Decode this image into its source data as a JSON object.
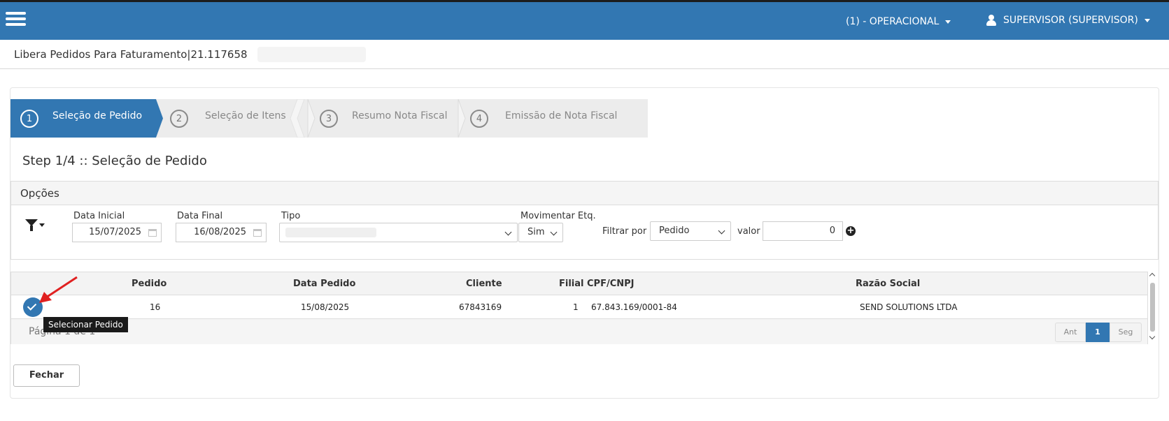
{
  "header": {
    "unit_label": "(1) - OPERACIONAL",
    "user_label": "SUPERVISOR (SUPERVISOR)"
  },
  "page": {
    "title": "Libera Pedidos Para Faturamento|21.117658"
  },
  "wizard": {
    "steps": [
      {
        "num": "1",
        "label": "Seleção de Pedido",
        "active": true
      },
      {
        "num": "2",
        "label": "Seleção de Itens",
        "active": false
      },
      {
        "num": "3",
        "label": "Resumo Nota Fiscal",
        "active": false
      },
      {
        "num": "4",
        "label": "Emissão de Nota Fiscal",
        "active": false
      }
    ],
    "heading": "Step 1/4 :: Seleção de Pedido"
  },
  "options": {
    "title": "Opções",
    "data_inicial_label": "Data Inicial",
    "data_inicial_value": "15/07/2025",
    "data_final_label": "Data Final",
    "data_final_value": "16/08/2025",
    "tipo_label": "Tipo",
    "mov_label": "Movimentar Etq.",
    "mov_value": "Sim",
    "filtrar_label": "Filtrar por",
    "filtrar_value": "Pedido",
    "valor_label": "valor",
    "valor_value": "0"
  },
  "grid": {
    "headers": {
      "pedido": "Pedido",
      "data_pedido": "Data Pedido",
      "cliente": "Cliente",
      "filial": "Filial",
      "cpf_cnpj": "CPF/CNPJ",
      "razao_social": "Razão Social"
    },
    "rows": [
      {
        "pedido": "16",
        "data_pedido": "15/08/2025",
        "cliente": "67843169",
        "filial": "1",
        "cpf_cnpj": "67.843.169/0001-84",
        "razao_social": "SEND SOLUTIONS LTDA"
      }
    ],
    "page_info": "Página 1 de 1",
    "pager": {
      "prev": "Ant",
      "current": "1",
      "next": "Seg"
    },
    "select_tooltip": "Selecionar Pedido"
  },
  "footer": {
    "close_label": "Fechar"
  },
  "colors": {
    "primary": "#3277b2",
    "step_inactive": "#ececec",
    "arrow": "#e02020"
  },
  "icons": [
    "menu-icon",
    "chevron-down-icon",
    "user-icon",
    "filter-icon",
    "calendar-icon",
    "plus-circle-icon",
    "check-icon",
    "arrow-icon"
  ]
}
